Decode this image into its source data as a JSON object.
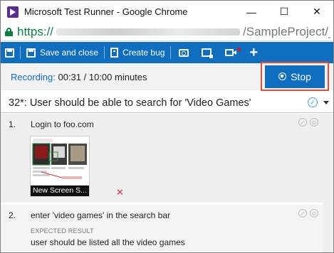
{
  "window": {
    "title": "Microsoft Test Runner - Google Chrome",
    "controls": [
      "—",
      "☐",
      "✕"
    ]
  },
  "address": {
    "scheme": "https://",
    "path": "/SampleProject/_te"
  },
  "toolbar": {
    "save_close_label": "Save and close",
    "create_bug_label": "Create bug",
    "icons": [
      "save-icon",
      "bug-icon",
      "camera-icon",
      "screen-capture-icon",
      "video-record-icon",
      "plus-icon"
    ]
  },
  "recording": {
    "label": "Recording:",
    "time": " 00:31 / 10:00 minutes",
    "stop_label": "Stop"
  },
  "testcase": {
    "title": "32*: User should be able to search for 'Video Games'"
  },
  "steps": [
    {
      "num": "1.",
      "text": "Login to foo.com",
      "attachment_caption": "New Screen S..."
    },
    {
      "num": "2.",
      "text": "enter 'video games' in the search bar",
      "expected_label": "EXPECTED RESULT",
      "expected_value": "user should be listed all the video games"
    }
  ],
  "colors": {
    "accent": "#106ebe",
    "highlight": "#e34c3c",
    "secure": "#0b8043"
  }
}
